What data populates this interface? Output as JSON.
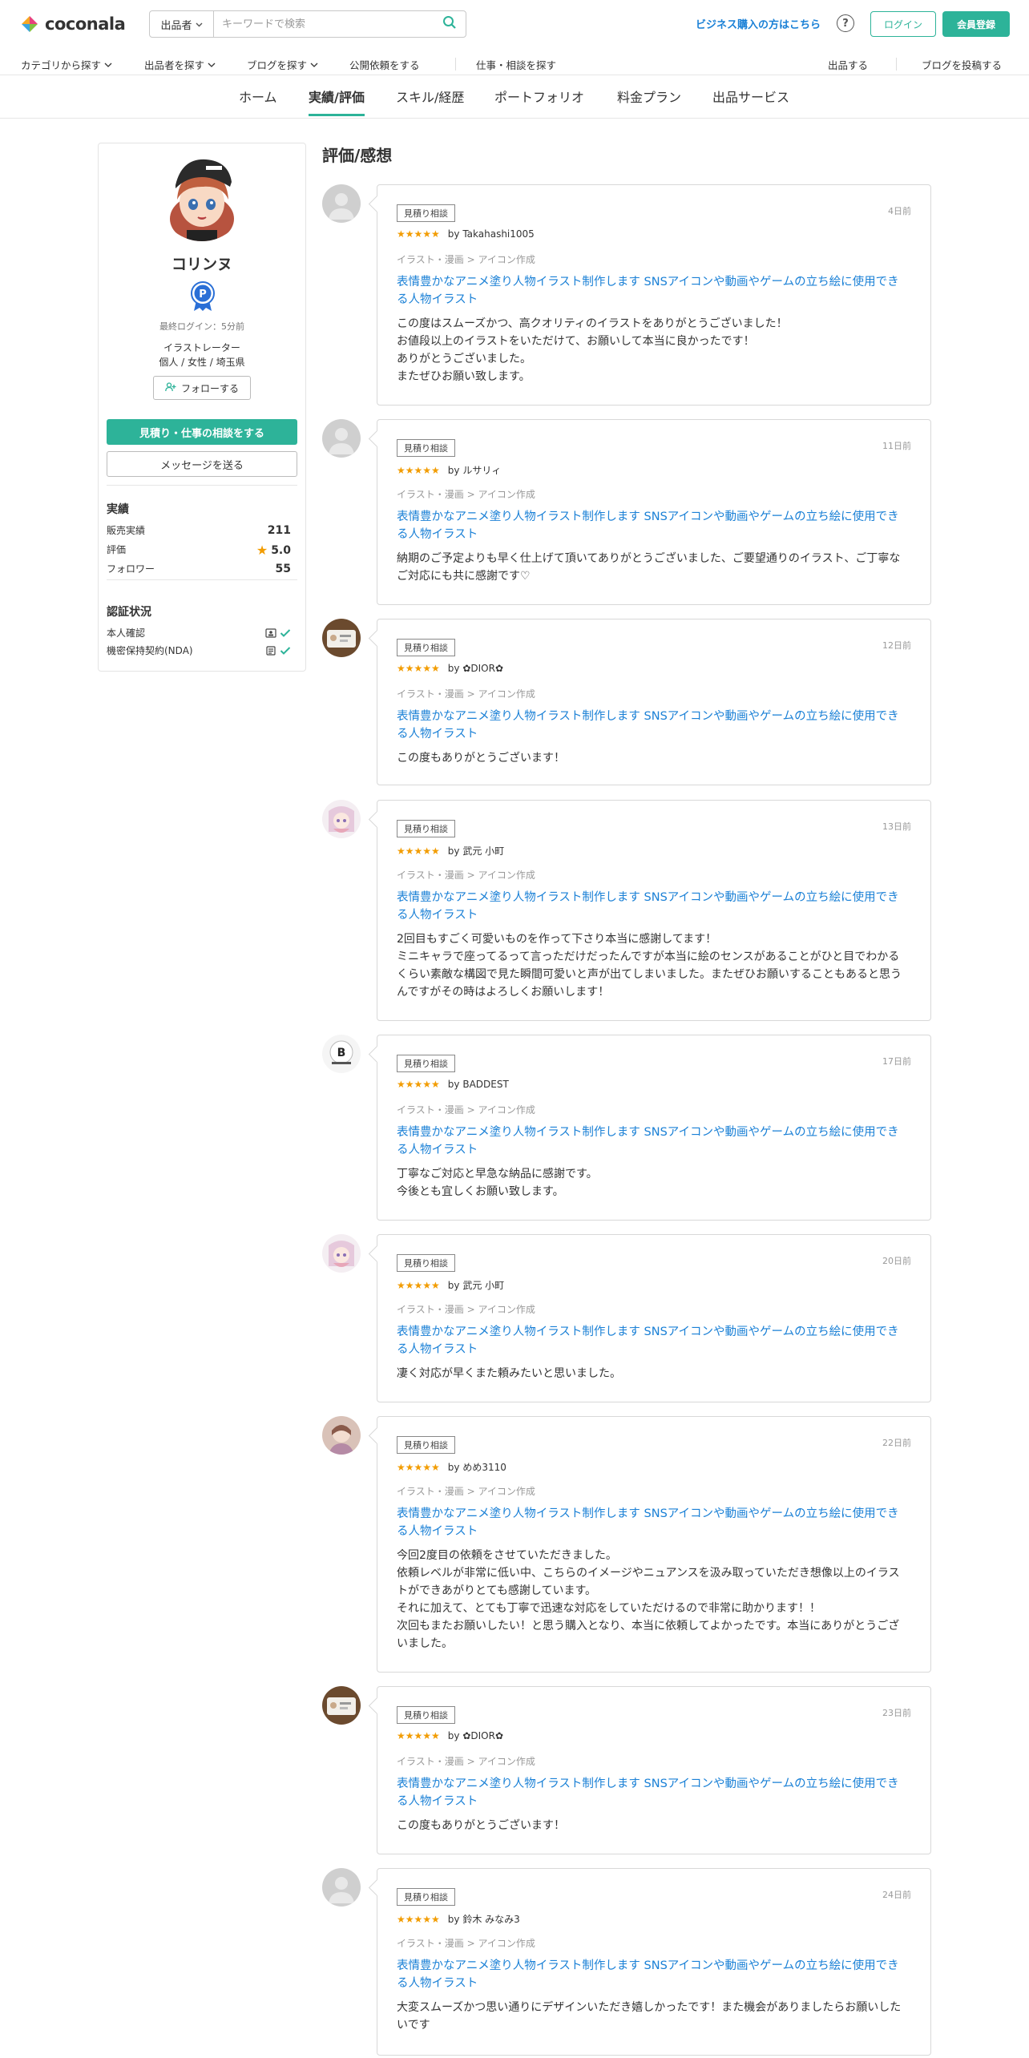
{
  "header": {
    "logo_text": "coconala",
    "search_select_label": "出品者",
    "search_placeholder": "キーワードで検索",
    "business_link": "ビジネス購入の方はこちら",
    "help_label": "?",
    "login_label": "ログイン",
    "signup_label": "会員登録"
  },
  "subnav": {
    "category": "カテゴリから探す",
    "sellers": "出品者を探す",
    "blogs": "ブログを探す",
    "requests": "公開依頼をする",
    "work": "仕事・相談を探す",
    "sell": "出品する",
    "post_blog": "ブログを投稿する"
  },
  "tabs": [
    "ホーム",
    "実績/評価",
    "スキル/経歴",
    "ポートフォリオ",
    "料金プラン",
    "出品サービス"
  ],
  "profile": {
    "name": "コリンヌ",
    "last_login": "最終ログイン：5分前",
    "occupation": "イラストレーター",
    "meta": "個人 / 女性 / 埼玉県",
    "follow_label": "フォローする",
    "consult_label": "見積り・仕事の相談をする",
    "message_label": "メッセージを送る",
    "stats_title": "実績",
    "stats": [
      {
        "label": "販売実績",
        "value": "211"
      },
      {
        "label": "評価",
        "value": "5.0"
      },
      {
        "label": "フォロワー",
        "value": "55"
      }
    ],
    "verify_title": "認証状況",
    "verifications": [
      {
        "label": "本人確認"
      },
      {
        "label": "機密保持契約(NDA)"
      }
    ]
  },
  "reviews_title": "評価/感想",
  "reviews": [
    {
      "tag": "見積り相談",
      "date": "4日前",
      "stars": "★★★★★",
      "user": "by Takahashi1005",
      "category": "イラスト・漫画 > アイコン作成",
      "service": "表情豊かなアニメ塗り人物イラスト制作します SNSアイコンや動画やゲームの立ち絵に使用できる人物イラスト",
      "comment": "この度はスムーズかつ、高クオリティのイラストをありがとうございました！\nお値段以上のイラストをいただけて、お願いして本当に良かったです！\nありがとうございました。\nまたぜひお願い致します。"
    },
    {
      "tag": "見積り相談",
      "date": "11日前",
      "stars": "★★★★★",
      "user": "by ルサリィ",
      "category": "イラスト・漫画 > アイコン作成",
      "service": "表情豊かなアニメ塗り人物イラスト制作します SNSアイコンや動画やゲームの立ち絵に使用できる人物イラスト",
      "comment": "納期のご予定よりも早く仕上げて頂いてありがとうございました、ご要望通りのイラスト、ご丁寧なご対応にも共に感謝です♡"
    },
    {
      "tag": "見積り相談",
      "date": "12日前",
      "stars": "★★★★★",
      "user": "by ✿DIOR✿",
      "category": "イラスト・漫画 > アイコン作成",
      "service": "表情豊かなアニメ塗り人物イラスト制作します SNSアイコンや動画やゲームの立ち絵に使用できる人物イラスト",
      "comment": "この度もありがとうございます！"
    },
    {
      "tag": "見積り相談",
      "date": "13日前",
      "stars": "★★★★★",
      "user": "by 武元 小町",
      "category": "イラスト・漫画 > アイコン作成",
      "service": "表情豊かなアニメ塗り人物イラスト制作します SNSアイコンや動画やゲームの立ち絵に使用できる人物イラスト",
      "comment": "2回目もすごく可愛いものを作って下さり本当に感謝してます！\nミニキャラで座ってるって言っただけだったんですが本当に絵のセンスがあることがひと目でわかるくらい素敵な構図で見た瞬間可愛いと声が出てしまいました。またぜひお願いすることもあると思うんですがその時はよろしくお願いします！"
    },
    {
      "tag": "見積り相談",
      "date": "17日前",
      "stars": "★★★★★",
      "user": "by BADDEST",
      "category": "イラスト・漫画 > アイコン作成",
      "service": "表情豊かなアニメ塗り人物イラスト制作します SNSアイコンや動画やゲームの立ち絵に使用できる人物イラスト",
      "comment": "丁寧なご対応と早急な納品に感謝です。\n今後とも宜しくお願い致します。"
    },
    {
      "tag": "見積り相談",
      "date": "20日前",
      "stars": "★★★★★",
      "user": "by 武元 小町",
      "category": "イラスト・漫画 > アイコン作成",
      "service": "表情豊かなアニメ塗り人物イラスト制作します SNSアイコンや動画やゲームの立ち絵に使用できる人物イラスト",
      "comment": "凄く対応が早くまた頼みたいと思いました。"
    },
    {
      "tag": "見積り相談",
      "date": "22日前",
      "stars": "★★★★★",
      "user": "by めめ3110",
      "category": "イラスト・漫画 > アイコン作成",
      "service": "表情豊かなアニメ塗り人物イラスト制作します SNSアイコンや動画やゲームの立ち絵に使用できる人物イラスト",
      "comment": "今回2度目の依頼をさせていただきました。\n依頼レベルが非常に低い中、こちらのイメージやニュアンスを汲み取っていただき想像以上のイラストができあがりとても感謝しています。\nそれに加えて、とても丁寧で迅速な対応をしていただけるので非常に助かります！！\n次回もまたお願いしたい！と思う購入となり、本当に依頼してよかったです。本当にありがとうございました。"
    },
    {
      "tag": "見積り相談",
      "date": "23日前",
      "stars": "★★★★★",
      "user": "by ✿DIOR✿",
      "category": "イラスト・漫画 > アイコン作成",
      "service": "表情豊かなアニメ塗り人物イラスト制作します SNSアイコンや動画やゲームの立ち絵に使用できる人物イラスト",
      "comment": "この度もありがとうございます！"
    },
    {
      "tag": "見積り相談",
      "date": "24日前",
      "stars": "★★★★★",
      "user": "by 鈴木 みなみ3",
      "category": "イラスト・漫画 > アイコン作成",
      "service": "表情豊かなアニメ塗り人物イラスト制作します SNSアイコンや動画やゲームの立ち絵に使用できる人物イラスト",
      "comment": "大変スムーズかつ思い通りにデザインいただき嬉しかったです！また機会がありましたらお願いしたいです"
    }
  ],
  "colors": {
    "brand": "#2db399",
    "link": "#1a80d6",
    "star": "#f29c00"
  }
}
